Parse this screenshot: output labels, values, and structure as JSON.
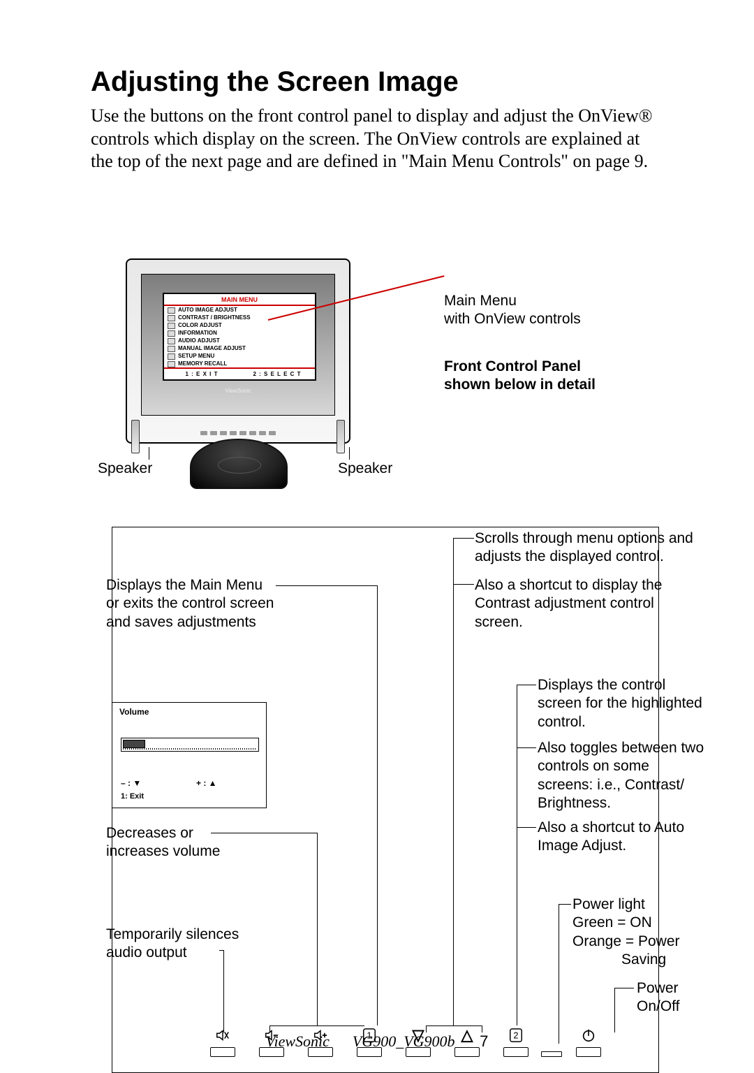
{
  "heading": "Adjusting the Screen Image",
  "intro": "Use the buttons on the front control panel to display and adjust the OnView® controls which display on the screen. The OnView controls are explained at the top of the next page and are defined in \"Main Menu Controls\" on page 9.",
  "monitor": {
    "menu_title": "MAIN MENU",
    "items": [
      "AUTO IMAGE ADJUST",
      "CONTRAST / BRIGHTNESS",
      "COLOR ADJUST",
      "INFORMATION",
      "AUDIO ADJUST",
      "MANUAL IMAGE ADJUST",
      "SETUP MENU",
      "MEMORY RECALL"
    ],
    "footer_left": "1 : E X I T",
    "footer_right": "2 : S E L E C T",
    "brand": "ViewSonic"
  },
  "labels": {
    "main_menu": "Main Menu\nwith OnView controls",
    "front_panel": "Front Control Panel\nshown below in detail",
    "speaker_left": "Speaker",
    "speaker_right": "Speaker",
    "btn1": "Displays the Main Menu\nor exits the control screen\nand saves adjustments",
    "scroll": "Scrolls through menu options and\nadjusts the displayed control.",
    "contrast_shortcut": "Also a shortcut to display the\nContrast adjustment control\nscreen.",
    "btn2a": "Displays the control\nscreen for the highlighted\ncontrol.",
    "btn2b": "Also toggles between two\ncontrols on some\nscreens: i.e., Contrast/\nBrightness.",
    "btn2c": "Also a shortcut to Auto\nImage Adjust.",
    "vol": "Decreases or\nincreases volume",
    "mute": "Temporarily silences\naudio output",
    "power_light": "Power light\nGreen = ON\nOrange = Power\n            Saving",
    "power": "Power\nOn/Off"
  },
  "volume_osd": {
    "title": "Volume",
    "minus": "– : ▼",
    "plus": "+ : ▲",
    "exit": "1: Exit"
  },
  "footer": {
    "brand": "ViewSonic",
    "model": "VG900_VG900b",
    "page": "7"
  }
}
